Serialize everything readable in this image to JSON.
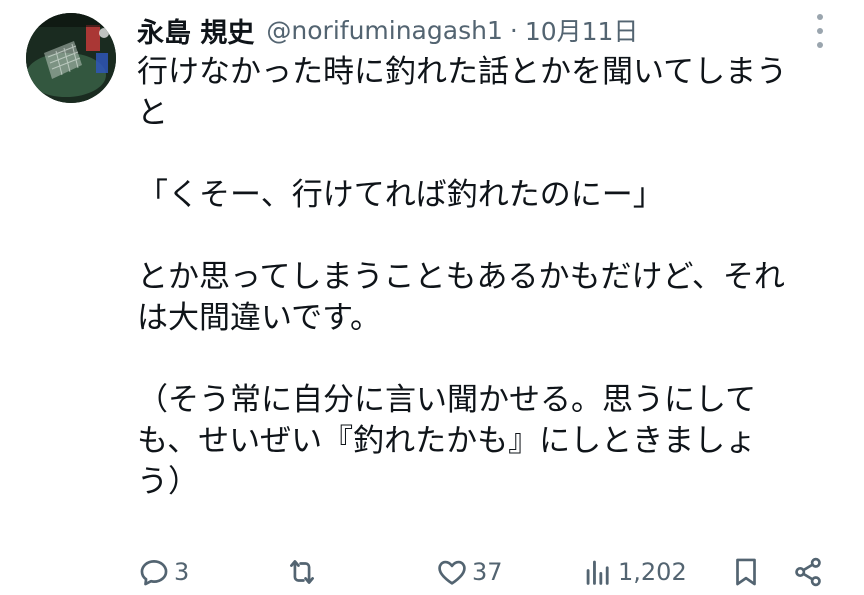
{
  "user": {
    "display_name": "永島 規史",
    "handle": "@norifuminagash1",
    "separator": "·",
    "date": "10月11日",
    "avatar": "avatar-photo"
  },
  "tweet": {
    "lines": [
      "行けなかった時に釣れた話とかを聞いてしまう",
      "と",
      "",
      "「くそー、行けてれば釣れたのにー」",
      "",
      "とか思ってしまうこともあるかもだけど、それ",
      "は大間違いです。",
      "",
      "（そう常に自分に言い聞かせる。思うにして",
      "も、せいぜい『釣れたかも』にしときましょ",
      "う）"
    ]
  },
  "actions": {
    "reply": {
      "icon": "reply-icon",
      "count": "3"
    },
    "retweet": {
      "icon": "retweet-icon",
      "count": ""
    },
    "like": {
      "icon": "heart-icon",
      "count": "37"
    },
    "views": {
      "icon": "views-icon",
      "count": "1,202"
    },
    "bookmark": {
      "icon": "bookmark-icon"
    },
    "share": {
      "icon": "share-icon"
    }
  },
  "colors": {
    "text": "#0f1419",
    "secondary": "#536471",
    "background": "#ffffff"
  }
}
